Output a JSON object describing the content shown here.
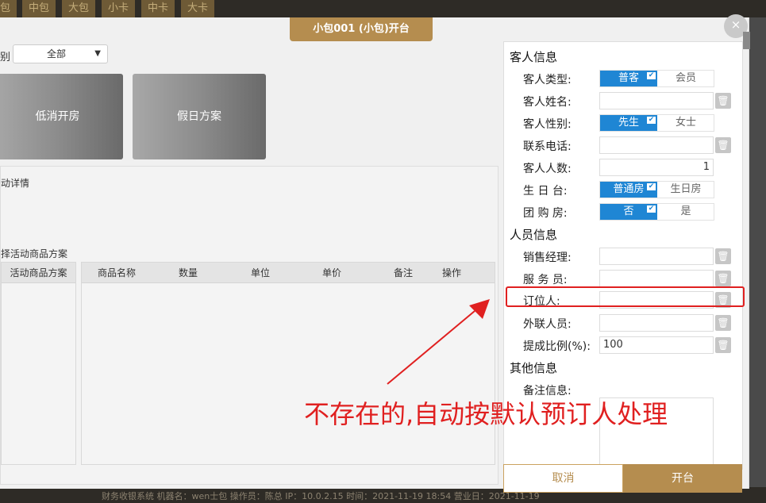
{
  "background": {
    "tabs": [
      "包",
      "中包",
      "大包",
      "小卡",
      "中卡",
      "大卡"
    ],
    "status_bar": "财务收银系统    机器名：wen士包   操作员：陈总   IP：10.0.2.15   时间：2021-11-19 18:54   营业日：2021-11-19"
  },
  "modal": {
    "title": "小包001 (小包)开台",
    "close": "×"
  },
  "left": {
    "filter_label": "别",
    "filter_value": "全部",
    "cards": [
      "低消开房",
      "假日方案"
    ],
    "detail_title": "动详情",
    "plan_title": "择活动商品方案",
    "plan_header": "活动商品方案",
    "goods_headers": [
      "商品名称",
      "数量",
      "单位",
      "单价",
      "备注",
      "操作"
    ]
  },
  "right": {
    "guest_section": "客人信息",
    "guest_type": {
      "label": "客人类型:",
      "on": "普客",
      "off": "会员"
    },
    "guest_name": {
      "label": "客人姓名:",
      "value": ""
    },
    "guest_gender": {
      "label": "客人性别:",
      "on": "先生",
      "off": "女士"
    },
    "phone": {
      "label": "联系电话:",
      "value": ""
    },
    "guest_count": {
      "label": "客人人数:",
      "value": "1"
    },
    "birthday": {
      "label": "生 日 台:",
      "on": "普通房",
      "off": "生日房"
    },
    "group_buy": {
      "label": "团 购 房:",
      "on": "否",
      "off": "是"
    },
    "staff_section": "人员信息",
    "sales_manager": {
      "label": "销售经理:",
      "value": ""
    },
    "waiter": {
      "label": "服 务 员:",
      "value": ""
    },
    "booker": {
      "label": "订位人:",
      "value": ""
    },
    "outside_staff": {
      "label": "外联人员:",
      "value": ""
    },
    "commission": {
      "label": "提成比例(%):",
      "value": "100"
    },
    "other_section": "其他信息",
    "memo": {
      "label": "备注信息:"
    }
  },
  "buttons": {
    "cancel": "取消",
    "open": "开台"
  },
  "annotation": {
    "text": "不存在的,自动按默认预订人处理",
    "color": "#e02020"
  },
  "colors": {
    "accent": "#b58d4f",
    "toggle_on": "#1f86d4"
  },
  "icons": [
    "close-icon",
    "trash-icon",
    "check-icon",
    "chevron-down-icon",
    "arrow-icon"
  ]
}
